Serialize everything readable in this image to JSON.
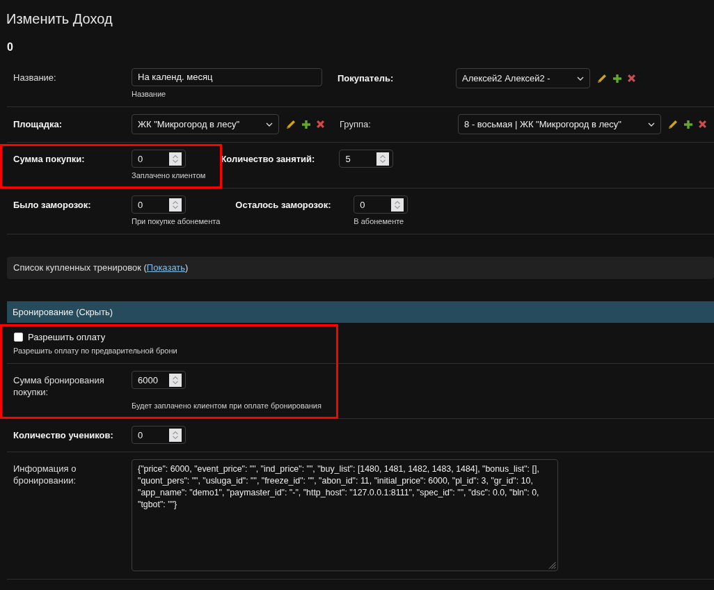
{
  "page": {
    "title": "Изменить Доход",
    "subtitle": "0"
  },
  "rows": [
    {
      "fields": [
        {
          "kind": "text",
          "label": "Название:",
          "required": false,
          "value": "На календ. месяц",
          "help": "Название",
          "highlighted": false
        },
        {
          "kind": "select",
          "label": "Покупатель:",
          "required": true,
          "value": "Алексей2 Алексей2 -",
          "related_actions": true,
          "highlighted": false
        }
      ]
    },
    {
      "fields": [
        {
          "kind": "select",
          "label": "Площадка:",
          "required": true,
          "value": "ЖК \"Микрогород в лесу\"",
          "related_actions": true,
          "highlighted": false
        },
        {
          "kind": "select",
          "label": "Группа:",
          "required": false,
          "value": "8 - восьмая | ЖК \"Микрогород в лесу\"",
          "related_actions": true,
          "highlighted": false
        }
      ]
    },
    {
      "fields": [
        {
          "kind": "number",
          "label": "Сумма покупки:",
          "required": true,
          "value": "0",
          "help": "Заплачено клиентом",
          "highlighted": true
        },
        {
          "kind": "number",
          "label": "Количество занятий:",
          "required": true,
          "value": "5",
          "highlighted": false
        }
      ]
    },
    {
      "fields": [
        {
          "kind": "number",
          "label": "Было заморозок:",
          "required": true,
          "value": "0",
          "help": "При покупке абонемента",
          "highlighted": false
        },
        {
          "kind": "number",
          "label": "Осталось заморозок:",
          "required": true,
          "value": "0",
          "help": "В абонементе",
          "highlighted": false
        }
      ]
    }
  ],
  "sections": [
    {
      "title": "Список купленных тренировок (",
      "toggle_link": "Показать",
      "title_end": ")",
      "expanded": false
    },
    {
      "title": "Бронирование (Скрыть)",
      "expanded": true,
      "rows": [
        {
          "fields": [
            {
              "kind": "checkbox",
              "label": "Разрешить оплату",
              "checked": false,
              "help": "Разрешить оплату по предварительной брони",
              "highlighted": true
            }
          ]
        },
        {
          "fields": [
            {
              "kind": "number",
              "label": "Сумма бронирования покупки:",
              "required": false,
              "value": "6000",
              "help": "Будет заплачено клиентом при оплате бронирования",
              "highlighted": true
            }
          ]
        },
        {
          "fields": [
            {
              "kind": "number",
              "label": "Количество учеников:",
              "required": true,
              "value": "0",
              "highlighted": false
            }
          ]
        },
        {
          "fields": [
            {
              "kind": "textarea",
              "label": "Информация о бронировании:",
              "required": false,
              "value": "{\"price\": 6000, \"event_price\": \"\", \"ind_price\": \"\", \"buy_list\": [1480, 1481, 1482, 1483, 1484], \"bonus_list\": [], \"quont_pers\": \"\", \"usluga_id\": \"\", \"freeze_id\": \"\", \"abon_id\": 11, \"initial_price\": 6000, \"pl_id\": 3, \"gr_id\": 10, \"app_name\": \"demo1\", \"paymaster_id\": \"-\", \"http_host\": \"127.0.0.1:8111\", \"spec_id\": \"\", \"dsc\": 0.0, \"bln\": 0, \"tgbot\": \"\"}",
              "highlighted": false
            }
          ]
        }
      ]
    }
  ]
}
